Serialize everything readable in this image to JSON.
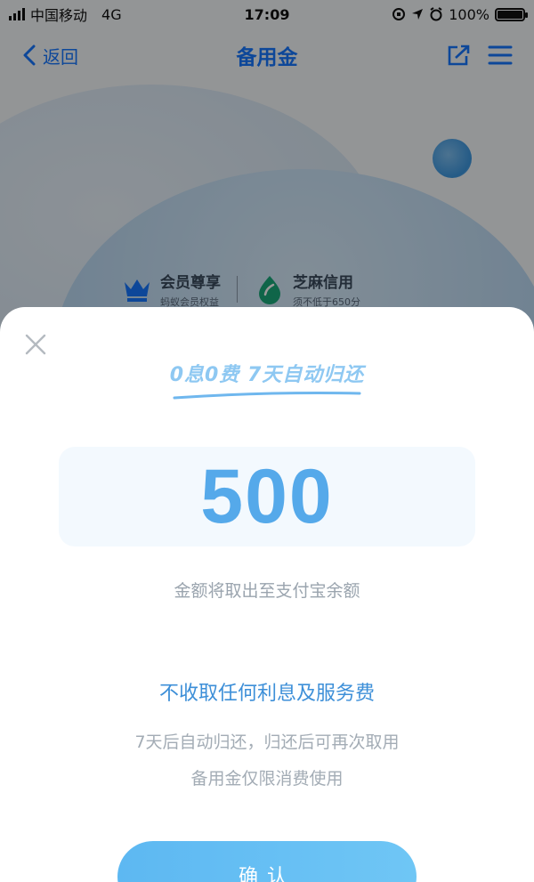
{
  "status_bar": {
    "carrier": "中国移动",
    "network": "4G",
    "time": "17:09",
    "battery": "100%"
  },
  "nav": {
    "back_label": "返回",
    "title": "备用金",
    "share_icon": "share-icon",
    "menu_icon": "menu-icon"
  },
  "benefits": [
    {
      "icon": "crown-icon",
      "title": "会员尊享",
      "subtitle": "蚂蚁会员权益"
    },
    {
      "icon": "sesame-icon",
      "title": "芝麻信用",
      "subtitle": "须不低于650分"
    }
  ],
  "modal": {
    "close_icon": "close-icon",
    "slogan": "0息0费 7天自动归还",
    "amount": "500",
    "amount_note": "金额将取出至支付宝余额",
    "headline": "不收取任何利息及服务费",
    "desc_line1": "7天后自动归还，归还后可再次取用",
    "desc_line2": "备用金仅限消费使用",
    "confirm_label": "确认"
  },
  "colors": {
    "accent": "#1677ff",
    "amount": "#55a9ea",
    "button": "#5db8f2"
  }
}
